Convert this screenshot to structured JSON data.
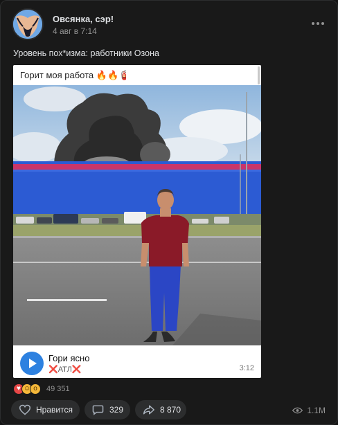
{
  "post": {
    "author": "Овсянка, сэр!",
    "date": "4 авг в 7:14",
    "text": "Уровень пох*изма: работники Озона"
  },
  "repost": {
    "text": "Горит моя работа",
    "text_emoji": "🔥🔥🧯"
  },
  "audio": {
    "title": "Гори ясно",
    "artist_mark": "❌",
    "artist": "АТЛ",
    "duration": "3:12"
  },
  "reactions": {
    "icons": [
      "heart-icon",
      "laugh-icon",
      "wow-icon"
    ],
    "count": "49 351"
  },
  "actions": {
    "like_label": "Нравится",
    "comments_count": "329",
    "shares_count": "8 870",
    "views_count": "1.1M"
  }
}
